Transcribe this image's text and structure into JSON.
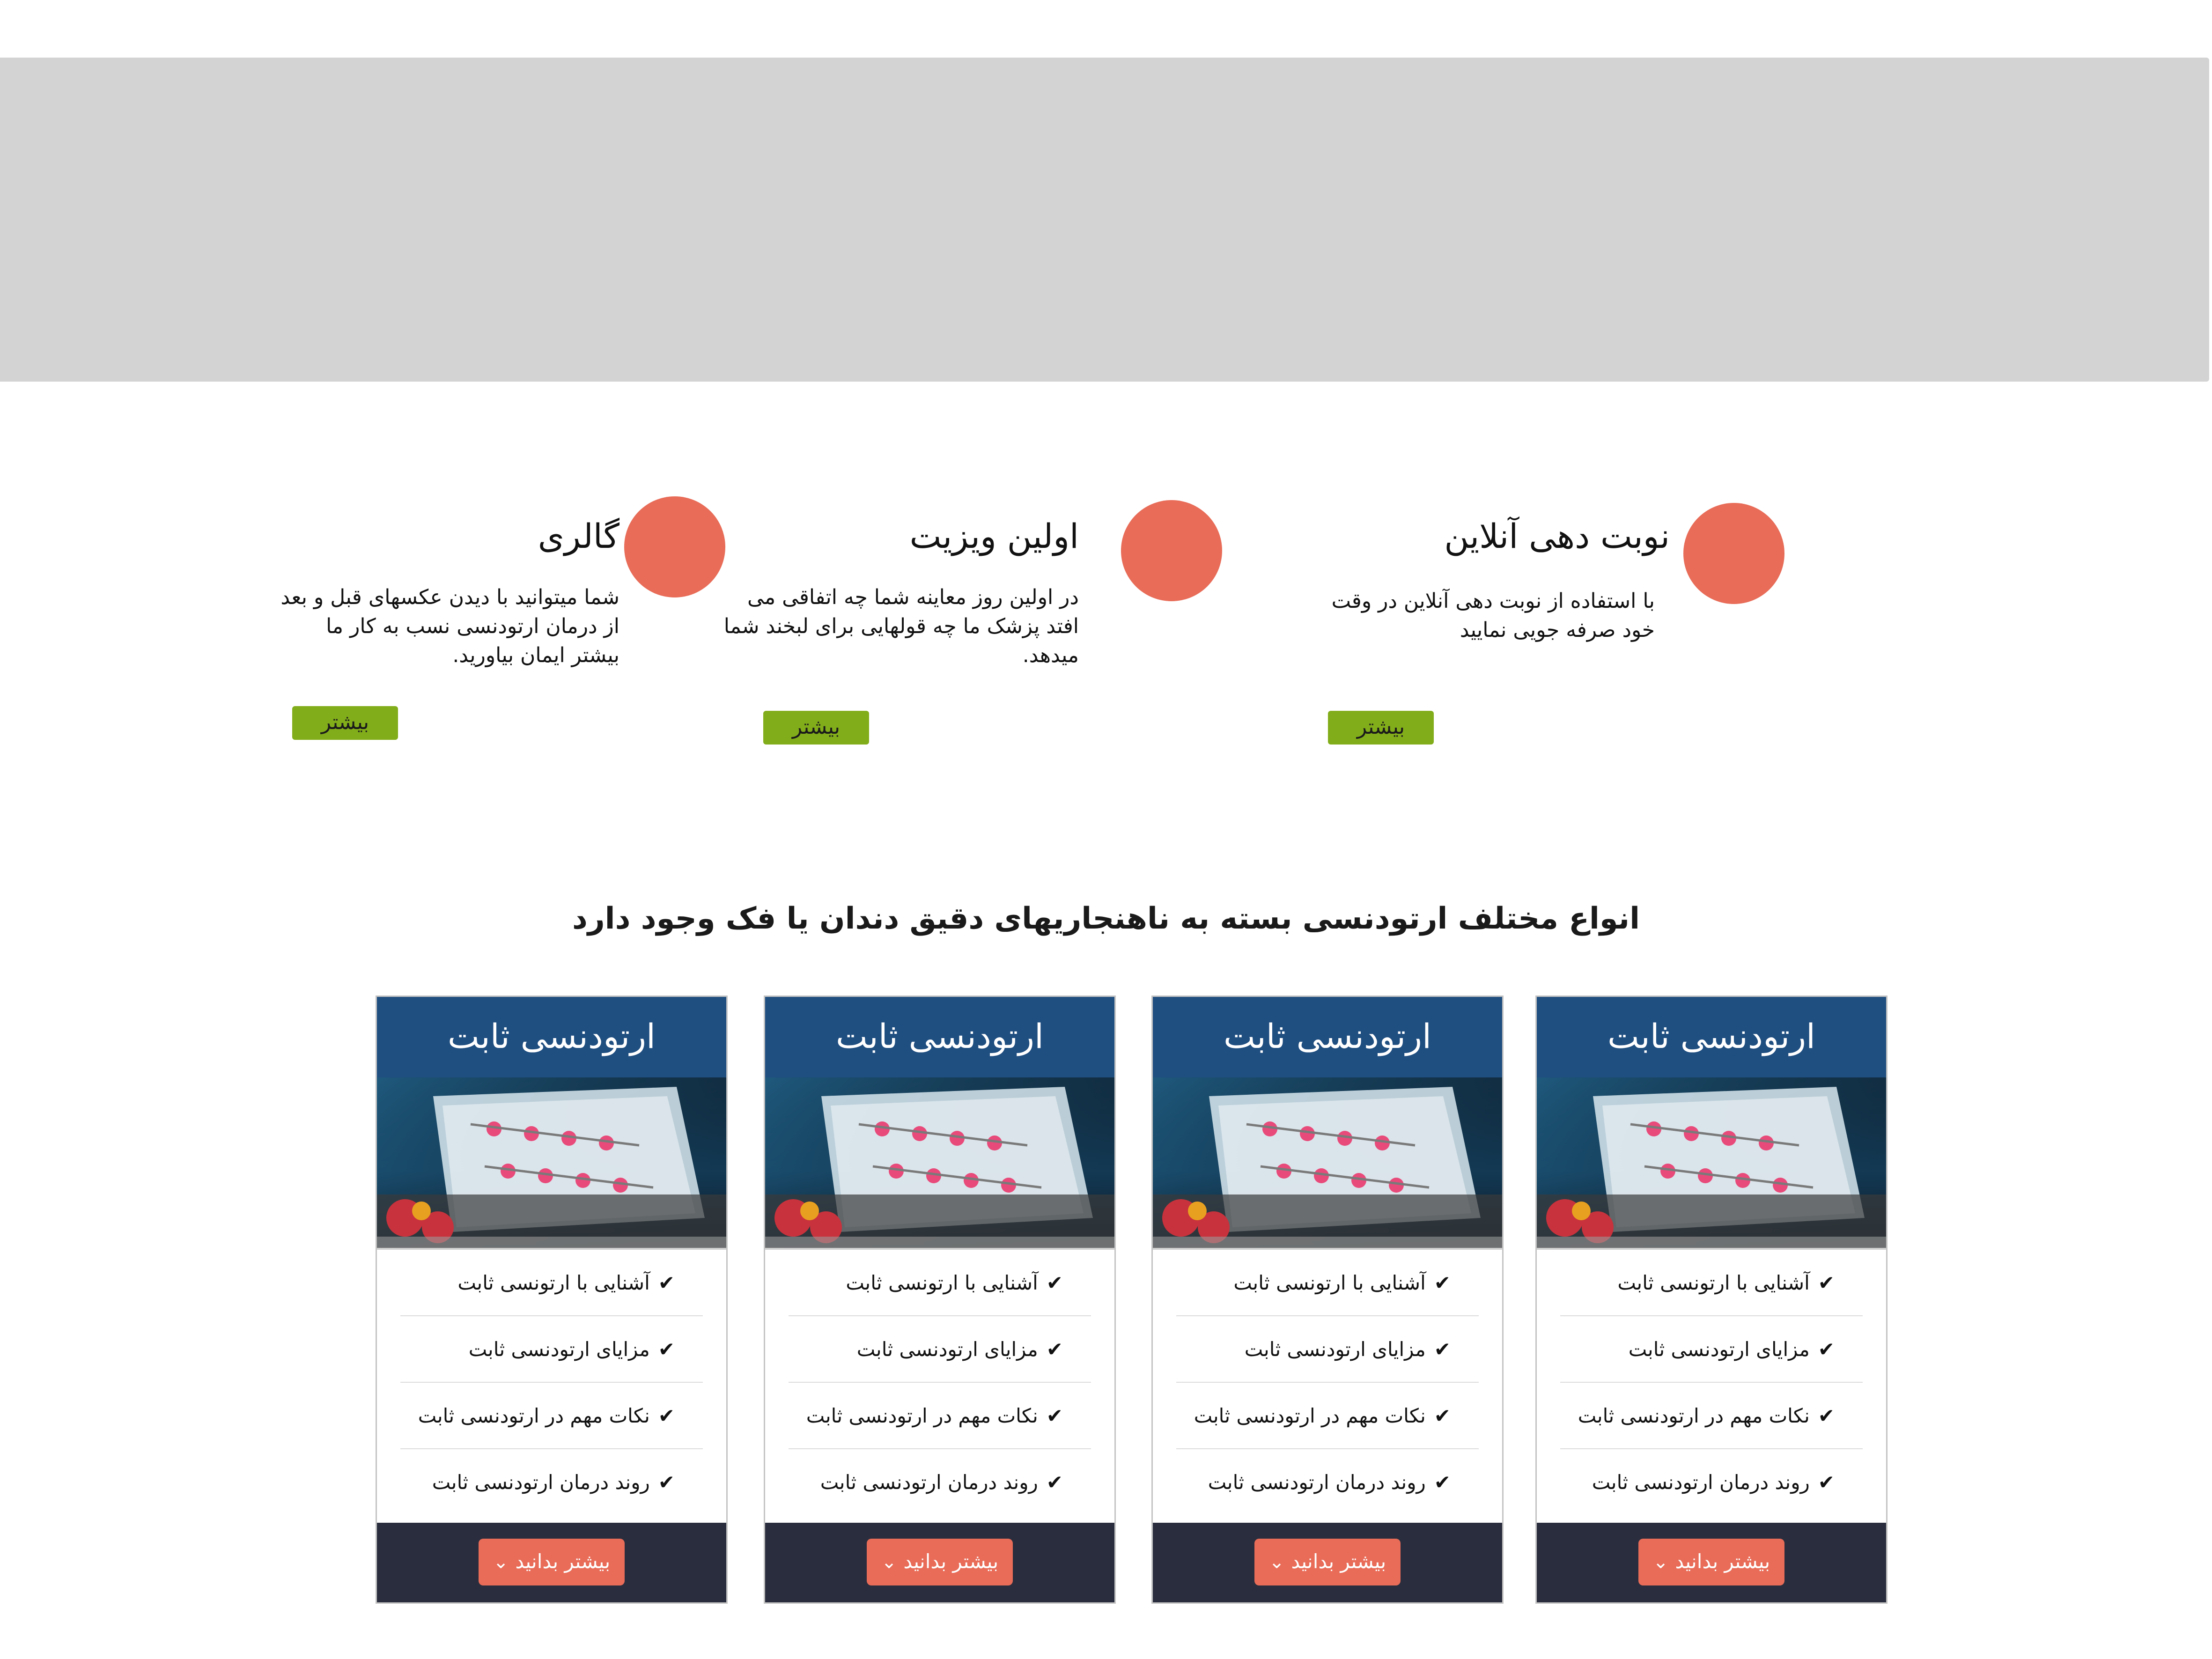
{
  "features": [
    {
      "title": "نوبت دهی آنلاین",
      "description": "با استفاده از نوبت دهی آنلاین در وقت خود صرفه جویی نمایید",
      "button": "بیشتر",
      "icon": "circle-icon"
    },
    {
      "title": "اولین ویزیت",
      "description": "در اولین روز معاینه شما چه اتفاقی می افتد پزشک ما چه قولهایی برای لبخند شما میدهد.",
      "button": "بیشتر",
      "icon": "circle-icon"
    },
    {
      "title": "گالری",
      "description": "شما میتوانید با دیدن عکسهای قبل و بعد از درمان ارتودنسی نسب به کار ما بیشتر ایمان بیاورید.",
      "button": "بیشتر",
      "icon": "circle-icon"
    }
  ],
  "section_heading": "انواع مختلف ارتودنسی بسته به ناهنجاریهای دقیق دندان یا فک وجود دارد",
  "cards": [
    {
      "title": "ارتودنسی ثابت",
      "items": [
        "آشنایی با ارتونسی ثابت",
        "مزایای ارتودنسی ثابت",
        "نکات مهم در ارتودنسی ثابت",
        "روند درمان ارتودنسی ثابت"
      ],
      "button": "بیشتر بدانید"
    },
    {
      "title": "ارتودنسی ثابت",
      "items": [
        "آشنایی با ارتونسی ثابت",
        "مزایای ارتودنسی ثابت",
        "نکات مهم در ارتودنسی ثابت",
        "روند درمان ارتودنسی ثابت"
      ],
      "button": "بیشتر بدانید"
    },
    {
      "title": "ارتودنسی ثابت",
      "items": [
        "آشنایی با ارتونسی ثابت",
        "مزایای ارتودنسی ثابت",
        "نکات مهم در ارتودنسی ثابت",
        "روند درمان ارتودنسی ثابت"
      ],
      "button": "بیشتر بدانید"
    },
    {
      "title": "ارتودنسی ثابت",
      "items": [
        "آشنایی با ارتونسی ثابت",
        "مزایای ارتودنسی ثابت",
        "نکات مهم در ارتودنسی ثابت",
        "روند درمان ارتودنسی ثابت"
      ],
      "button": "بیشتر بدانید"
    }
  ],
  "colors": {
    "hero": "#d3d3d3",
    "circle": "#e86c58",
    "feature_button": "#82ad1a",
    "card_header": "#1f4e80",
    "card_footer": "#2a2d3d",
    "card_button": "#e86c58"
  }
}
